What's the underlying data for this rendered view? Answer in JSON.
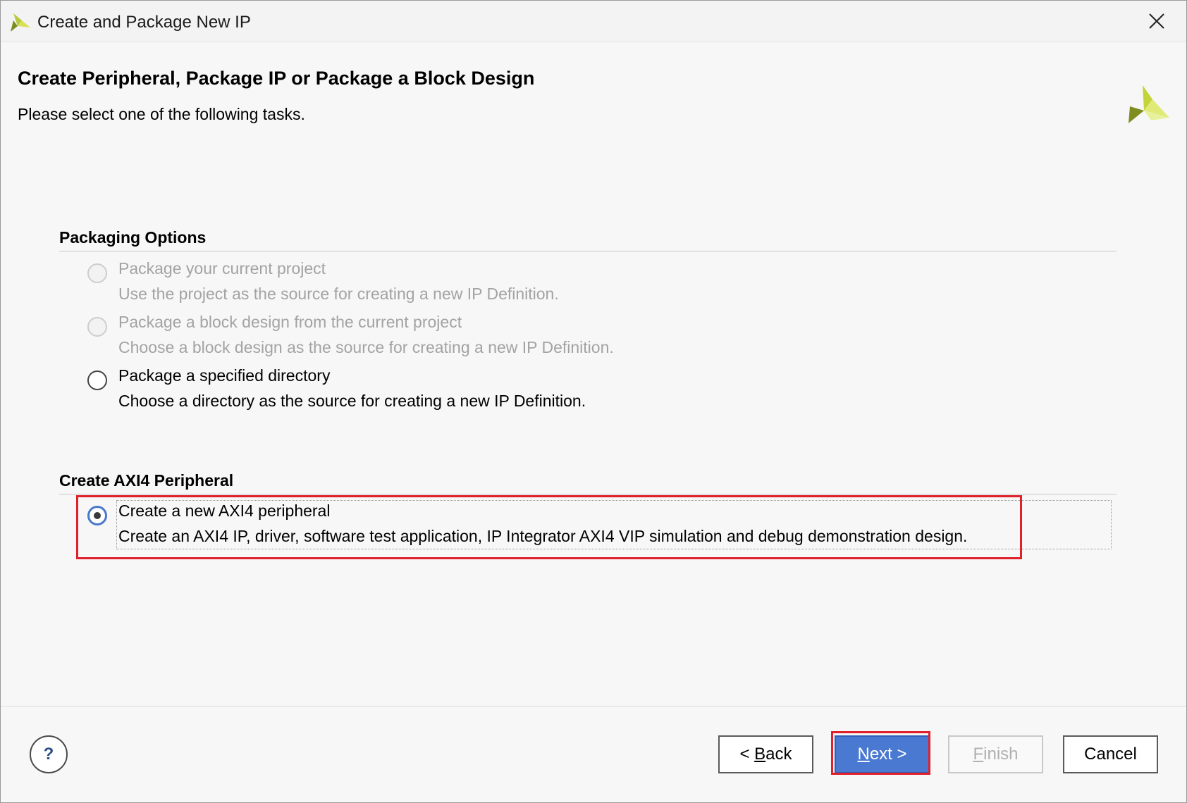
{
  "window": {
    "title": "Create and Package New IP",
    "close_icon": "close-icon",
    "logo_icon": "xilinx-logo-icon"
  },
  "header": {
    "title": "Create Peripheral, Package IP or Package a Block Design",
    "subtitle": "Please select one of the following tasks."
  },
  "packaging": {
    "section_title": "Packaging Options",
    "options": [
      {
        "label": "Package your current project",
        "description": "Use the project as the source for creating a new IP Definition.",
        "state": "disabled"
      },
      {
        "label": "Package a block design from the current project",
        "description": "Choose a block design as the source for creating a new IP Definition.",
        "state": "disabled"
      },
      {
        "label": "Package a specified directory",
        "description": "Choose a directory as the source for creating a new IP Definition.",
        "state": "unselected"
      }
    ]
  },
  "axi": {
    "section_title": "Create AXI4 Peripheral",
    "options": [
      {
        "label": "Create a new AXI4 peripheral",
        "description": "Create an AXI4 IP, driver, software test application, IP Integrator AXI4 VIP simulation and debug demonstration design.",
        "state": "selected"
      }
    ]
  },
  "footer": {
    "help_label": "?",
    "back_prefix": "< ",
    "back_mnemonic": "B",
    "back_rest": "ack",
    "next_mnemonic": "N",
    "next_rest": "ext >",
    "finish_mnemonic": "F",
    "finish_rest": "inish",
    "cancel_label": "Cancel",
    "finish_enabled": false
  },
  "colors": {
    "accent_blue": "#4a79d1",
    "highlight_red": "#e0202b",
    "disabled_text": "#a3a3a3"
  }
}
